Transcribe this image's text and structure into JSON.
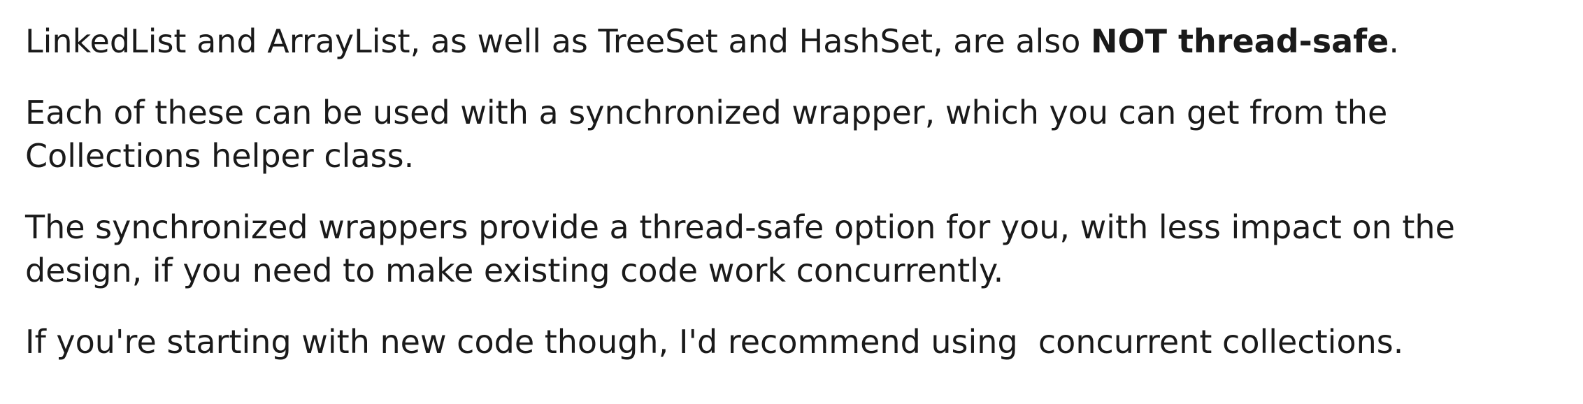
{
  "document": {
    "paragraphs": [
      {
        "pre": "LinkedList and ArrayList, as well as TreeSet and HashSet, are also ",
        "bold": "NOT thread-safe",
        "post": "."
      },
      {
        "text": "Each of these can be used with a synchronized wrapper, which you can get from the Collections helper class."
      },
      {
        "text": "The synchronized wrappers provide a thread-safe option for you, with less impact on the design, if you need to make existing code work concurrently."
      },
      {
        "text": "If you're starting with new code though, I'd recommend using  concurrent collections."
      }
    ]
  }
}
